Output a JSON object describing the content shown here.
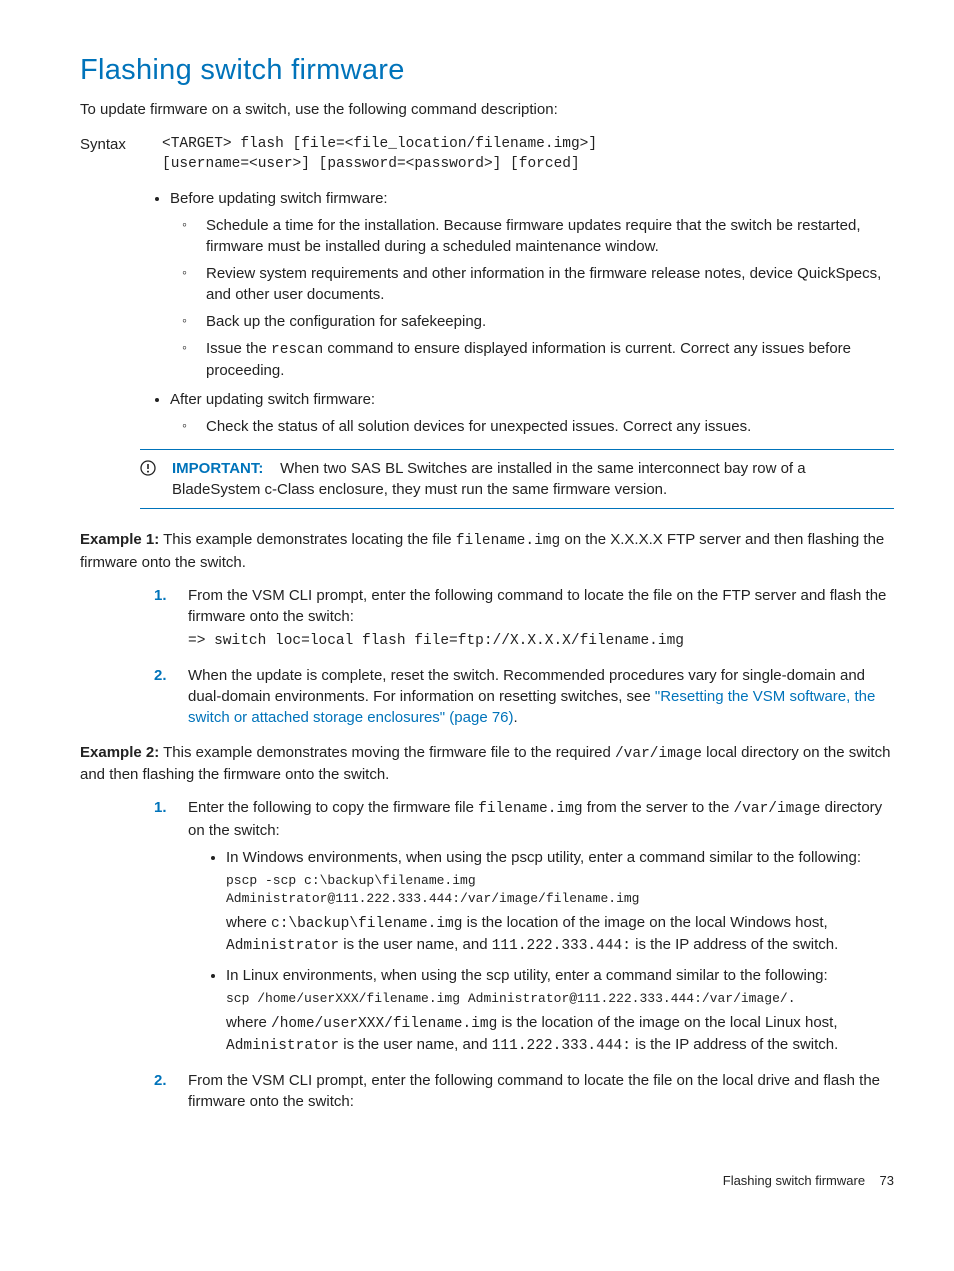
{
  "heading": "Flashing switch firmware",
  "intro": "To update firmware on a switch, use the following command description:",
  "syntax": {
    "label": "Syntax",
    "line1": "<TARGET> flash [file=<file_location/filename.img>]",
    "line2": "[username=<user>] [password=<password>] [forced]"
  },
  "bullets": {
    "before_label": "Before updating switch firmware:",
    "before_items": [
      "Schedule a time for the installation. Because firmware updates require that the switch be restarted, firmware must be installed during a scheduled maintenance window.",
      "Review system requirements and other information in the firmware release notes, device QuickSpecs, and other user documents.",
      "Back up the configuration for safekeeping."
    ],
    "rescan_pre": "Issue the ",
    "rescan_code": "rescan",
    "rescan_post": " command to ensure displayed information is current. Correct any issues before proceeding.",
    "after_label": "After updating switch firmware:",
    "after_items": [
      "Check the status of all solution devices for unexpected issues. Correct any issues."
    ]
  },
  "admon": {
    "label": "IMPORTANT:",
    "text": "When two SAS BL Switches are installed in the same interconnect bay row of a BladeSystem c-Class enclosure, they must run the same firmware version."
  },
  "ex1": {
    "title": "Example 1:",
    "intro_pre": " This example demonstrates locating the file ",
    "intro_code": "filename.img",
    "intro_post": " on the X.X.X.X FTP server and then flashing the firmware onto the switch.",
    "step1": "From the VSM CLI prompt, enter the following command to locate the file on the FTP server and flash the firmware onto the switch:",
    "step1_code": "=> switch loc=local flash file=ftp://X.X.X.X/filename.img",
    "step2_pre": "When the update is complete, reset the switch. Recommended procedures vary for single-domain and dual-domain environments. For information on resetting switches, see ",
    "step2_link": "\"Resetting the VSM software, the switch or attached storage enclosures\" (page 76)",
    "step2_post": "."
  },
  "ex2": {
    "title": "Example 2:",
    "intro_pre": " This example demonstrates moving the firmware file to the required ",
    "intro_code": "/var/image",
    "intro_post": " local directory on the switch and then flashing the firmware onto the switch.",
    "step1_pre": "Enter the following to copy the firmware file ",
    "step1_code1": "filename.img",
    "step1_mid": " from the server to the ",
    "step1_code2": "/var/image",
    "step1_post": " directory on the switch:",
    "win_intro": "In Windows environments, when using the pscp utility, enter a command similar to the following:",
    "win_cmd": "pscp -scp c:\\backup\\filename.img Administrator@111.222.333.444:/var/image/filename.img",
    "win_where_pre": "where ",
    "win_where_c1": "c:\\backup\\filename.img",
    "win_where_m1": " is the location of the image on the local Windows host, ",
    "win_where_c2": "Administrator",
    "win_where_m2": " is the user name, and ",
    "win_where_c3": "111.222.333.444:",
    "win_where_post": " is the IP address of the switch.",
    "lin_intro": "In Linux environments, when using the scp utility, enter a command similar to the following:",
    "lin_cmd": "scp /home/userXXX/filename.img Administrator@111.222.333.444:/var/image/.",
    "lin_where_pre": "where ",
    "lin_where_c1": "/home/userXXX/filename.img",
    "lin_where_m1": " is the location of the image on the local Linux host, ",
    "lin_where_c2": "Administrator",
    "lin_where_m2": " is the user name, and ",
    "lin_where_c3": "111.222.333.444:",
    "lin_where_post": " is the IP address of the switch.",
    "step2": "From the VSM CLI prompt, enter the following command to locate the file on the local drive and flash the firmware onto the switch:"
  },
  "footer": {
    "title": "Flashing switch firmware",
    "page": "73"
  }
}
